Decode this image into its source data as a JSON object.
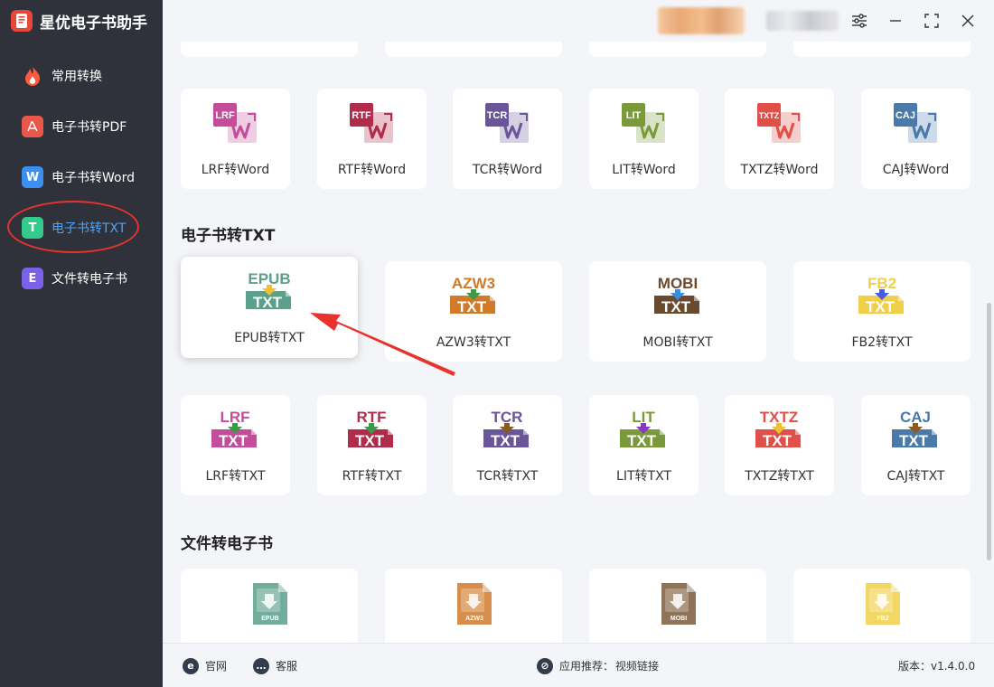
{
  "app": {
    "title": "星优电子书助手"
  },
  "sidebar": {
    "items": [
      {
        "label": "常用转换",
        "icon": "fire-icon",
        "color": "#ff5a3c"
      },
      {
        "label": "电子书转PDF",
        "icon": "pdf-icon",
        "color": "#e8574a"
      },
      {
        "label": "电子书转Word",
        "icon": "word-icon",
        "color": "#3b8ff0"
      },
      {
        "label": "电子书转TXT",
        "icon": "txt-icon",
        "color": "#35c98b",
        "active": true
      },
      {
        "label": "文件转电子书",
        "icon": "ebook-icon",
        "color": "#7b61e8"
      }
    ],
    "accent": "#4aa3ff"
  },
  "word_cards": [
    {
      "tag": "LRF",
      "color": "#c54c9a",
      "label": "LRF转Word"
    },
    {
      "tag": "RTF",
      "color": "#b02c4a",
      "label": "RTF转Word"
    },
    {
      "tag": "TCR",
      "color": "#6a559a",
      "label": "TCR转Word"
    },
    {
      "tag": "LIT",
      "color": "#7a9a3a",
      "label": "LIT转Word"
    },
    {
      "tag": "TXTZ",
      "color": "#e05048",
      "label": "TXTZ转Word"
    },
    {
      "tag": "CAJ",
      "color": "#4a7aaa",
      "label": "CAJ转Word"
    }
  ],
  "txt_section": {
    "title": "电子书转TXT",
    "row1": [
      {
        "tag": "EPUB",
        "color": "#5aa08c",
        "arrow": "#f0c030",
        "label": "EPUB转TXT",
        "selected": true
      },
      {
        "tag": "AZW3",
        "color": "#d07a2a",
        "arrow": "#3a9a4a",
        "label": "AZW3转TXT"
      },
      {
        "tag": "MOBI",
        "color": "#6a4a2e",
        "arrow": "#3a8ae0",
        "label": "MOBI转TXT"
      },
      {
        "tag": "FB2",
        "color": "#f0d04a",
        "arrow": "#4a5ae0",
        "label": "FB2转TXT"
      }
    ],
    "row2": [
      {
        "tag": "LRF",
        "color": "#c54c9a",
        "arrow": "#3a9a4a",
        "label": "LRF转TXT"
      },
      {
        "tag": "RTF",
        "color": "#b02c4a",
        "arrow": "#3a9a4a",
        "label": "RTF转TXT"
      },
      {
        "tag": "TCR",
        "color": "#6a559a",
        "arrow": "#8a5a20",
        "label": "TCR转TXT"
      },
      {
        "tag": "LIT",
        "color": "#7a9a3a",
        "arrow": "#8a3ac0",
        "label": "LIT转TXT"
      },
      {
        "tag": "TXTZ",
        "color": "#e05048",
        "arrow": "#f0c030",
        "label": "TXTZ转TXT"
      },
      {
        "tag": "CAJ",
        "color": "#4a7aaa",
        "arrow": "#8a5a20",
        "label": "CAJ转TXT"
      }
    ],
    "badge_text": "TXT"
  },
  "file_section": {
    "title": "文件转电子书",
    "cards": [
      {
        "tag": "EPUB",
        "color": "#5aa08c"
      },
      {
        "tag": "AZW3",
        "color": "#d07a2a"
      },
      {
        "tag": "MOBI",
        "color": "#7a5a3a"
      },
      {
        "tag": "FB2",
        "color": "#f0d04a"
      }
    ]
  },
  "footer": {
    "website": "官网",
    "support": "客服",
    "recommend": "应用推荐：",
    "video_link": "视频链接",
    "version": "版本：v1.4.0.0"
  }
}
